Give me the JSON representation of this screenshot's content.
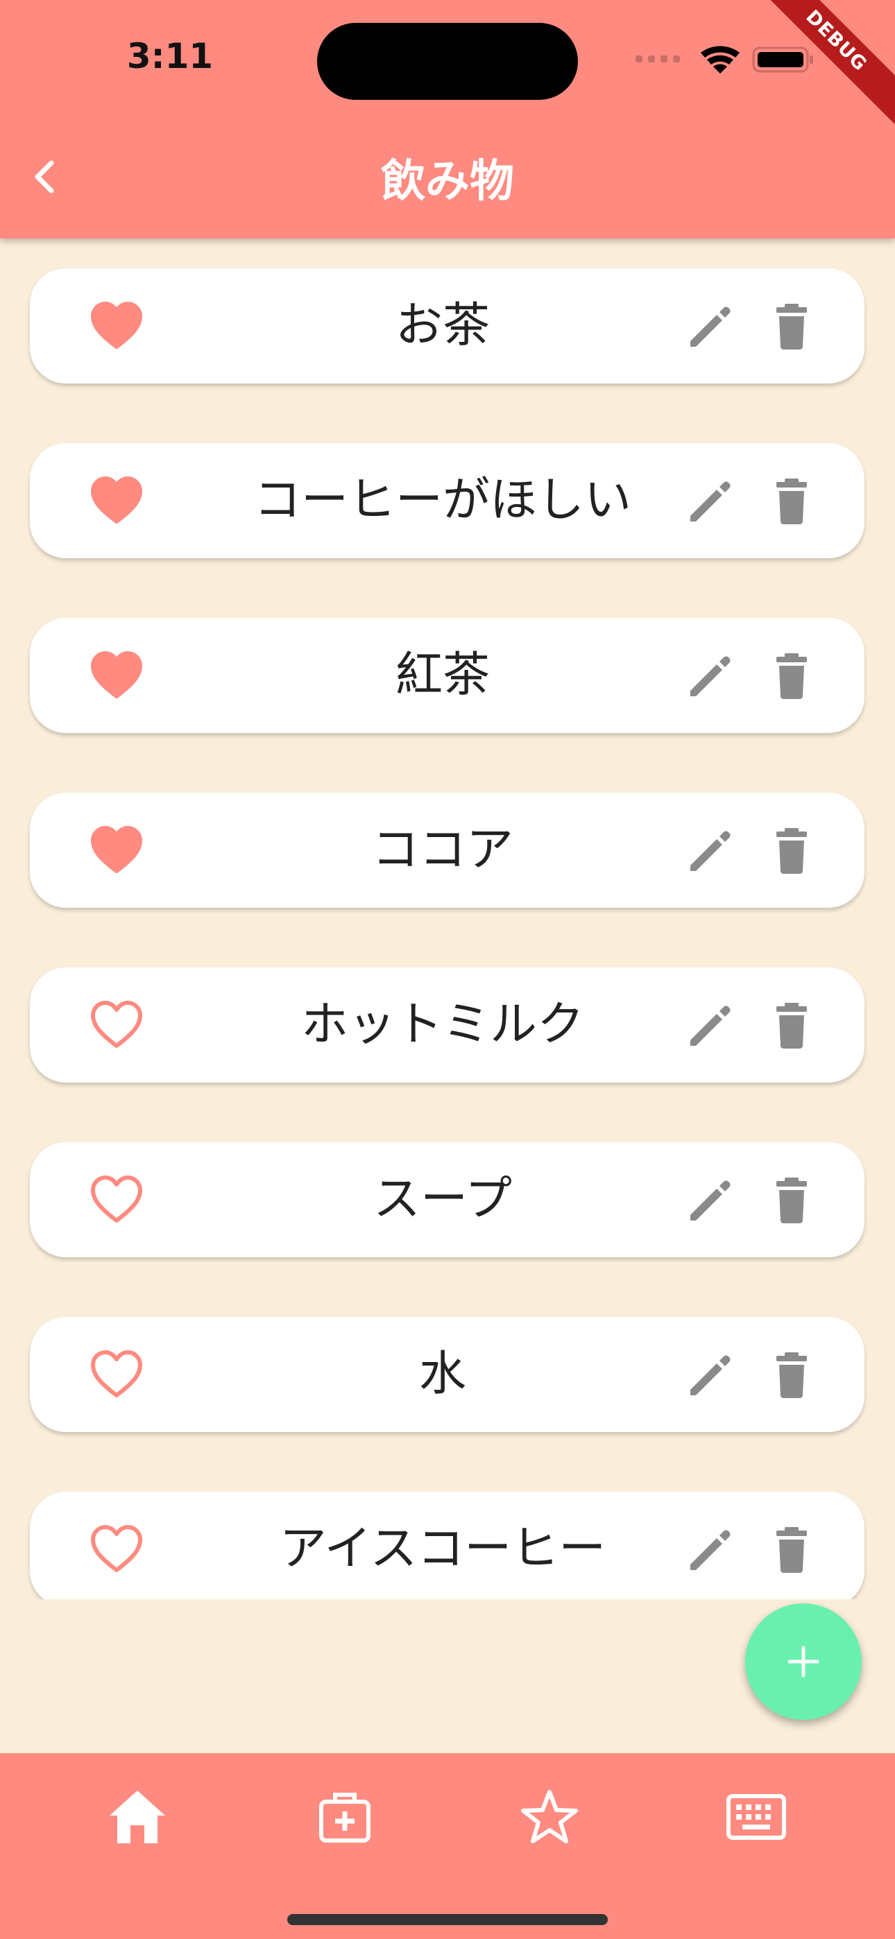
{
  "status_bar": {
    "time": "3:11",
    "debug_banner": "DEBUG"
  },
  "app_bar": {
    "title": "飲み物",
    "back_icon": "chevron-left-icon"
  },
  "items": [
    {
      "label": "お茶",
      "favorite": true
    },
    {
      "label": "コーヒーがほしい",
      "favorite": true
    },
    {
      "label": "紅茶",
      "favorite": true
    },
    {
      "label": "ココア",
      "favorite": true
    },
    {
      "label": "ホットミルク",
      "favorite": false
    },
    {
      "label": "スープ",
      "favorite": false
    },
    {
      "label": "水",
      "favorite": false
    },
    {
      "label": "アイスコーヒー",
      "favorite": false
    }
  ],
  "item_actions": {
    "edit_icon": "pencil-icon",
    "delete_icon": "trash-icon"
  },
  "fab": {
    "icon": "plus-icon"
  },
  "bottom_nav": {
    "items": [
      {
        "icon": "home-icon"
      },
      {
        "icon": "medical-kit-icon"
      },
      {
        "icon": "star-icon"
      },
      {
        "icon": "keyboard-icon"
      }
    ]
  },
  "colors": {
    "primary": "#FF8A80",
    "background": "#FAEEDA",
    "accent": "#69F0AE",
    "icon_gray": "#8A8A8A",
    "heart": "#FF8A80"
  }
}
